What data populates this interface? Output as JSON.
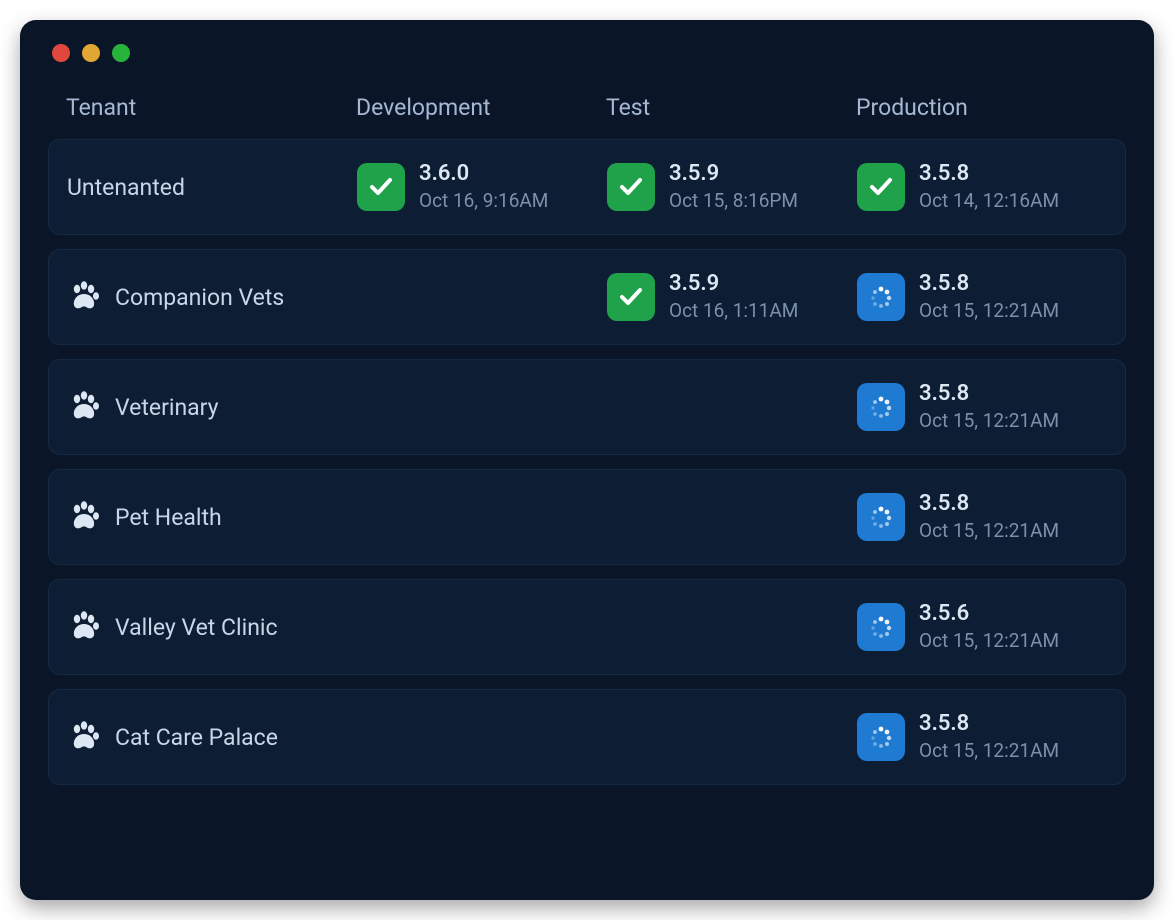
{
  "columns": {
    "tenant": "Tenant",
    "dev": "Development",
    "test": "Test",
    "prod": "Production"
  },
  "rows": [
    {
      "tenant": {
        "name": "Untenanted",
        "has_icon": false
      },
      "dev": {
        "status": "success",
        "version": "3.6.0",
        "timestamp": "Oct 16, 9:16AM"
      },
      "test": {
        "status": "success",
        "version": "3.5.9",
        "timestamp": "Oct 15, 8:16PM"
      },
      "prod": {
        "status": "success",
        "version": "3.5.8",
        "timestamp": "Oct 14, 12:16AM"
      }
    },
    {
      "tenant": {
        "name": "Companion Vets",
        "has_icon": true
      },
      "dev": null,
      "test": {
        "status": "success",
        "version": "3.5.9",
        "timestamp": "Oct 16, 1:11AM"
      },
      "prod": {
        "status": "pending",
        "version": "3.5.8",
        "timestamp": "Oct 15, 12:21AM"
      }
    },
    {
      "tenant": {
        "name": "Veterinary",
        "has_icon": true
      },
      "dev": null,
      "test": null,
      "prod": {
        "status": "pending",
        "version": "3.5.8",
        "timestamp": "Oct 15, 12:21AM"
      }
    },
    {
      "tenant": {
        "name": "Pet Health",
        "has_icon": true
      },
      "dev": null,
      "test": null,
      "prod": {
        "status": "pending",
        "version": "3.5.8",
        "timestamp": "Oct 15, 12:21AM"
      }
    },
    {
      "tenant": {
        "name": "Valley Vet Clinic",
        "has_icon": true
      },
      "dev": null,
      "test": null,
      "prod": {
        "status": "pending",
        "version": "3.5.6",
        "timestamp": "Oct 15, 12:21AM"
      }
    },
    {
      "tenant": {
        "name": "Cat Care Palace",
        "has_icon": true
      },
      "dev": null,
      "test": null,
      "prod": {
        "status": "pending",
        "version": "3.5.8",
        "timestamp": "Oct 15, 12:21AM"
      }
    }
  ]
}
